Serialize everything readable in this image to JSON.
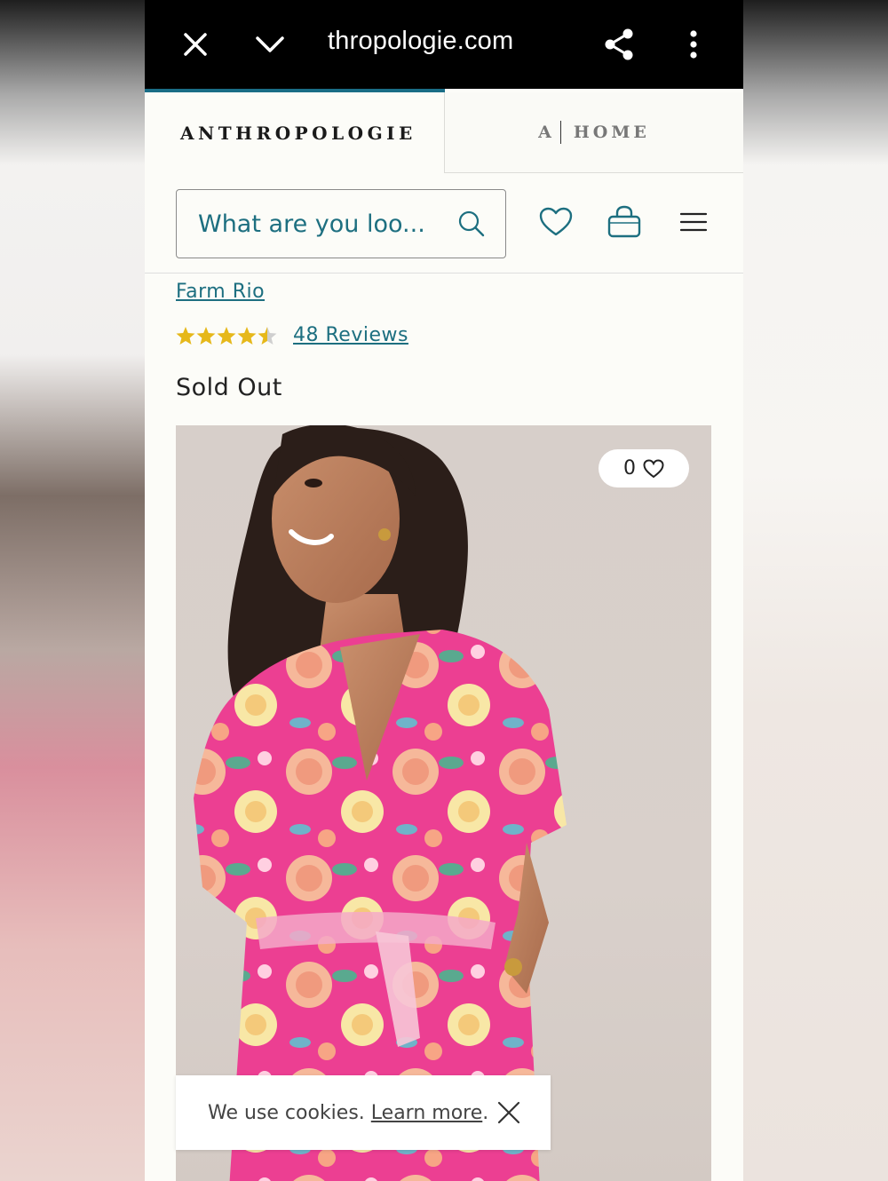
{
  "browser": {
    "url": "thropologie.com",
    "icons": [
      "close-icon",
      "chevron-down-icon",
      "share-icon",
      "more-vert-icon"
    ]
  },
  "brand_tabs": {
    "main": "ANTHROPOLOGIE",
    "home_prefix": "A",
    "home_label": "HOME"
  },
  "search": {
    "placeholder": "What are you loo..."
  },
  "header_icons": [
    "heart-icon",
    "shopping-bag-icon",
    "hamburger-menu-icon"
  ],
  "product": {
    "brand": "Farm Rio",
    "rating": 4.5,
    "rating_max": 5,
    "reviews": "48 Reviews",
    "status": "Sold Out",
    "favorites_count": "0"
  },
  "cookie_banner": {
    "text": "We use cookies.",
    "link": "Learn more",
    "suffix": "."
  },
  "colors": {
    "accent": "#1d6f80",
    "star": "#e6b81a",
    "progress": "#1a6d86"
  }
}
